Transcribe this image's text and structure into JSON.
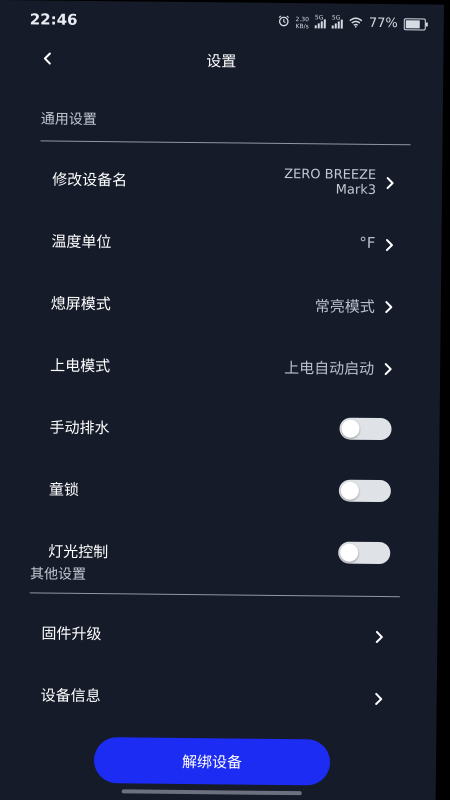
{
  "status_bar": {
    "time": "22:46",
    "net_speed_value": "2.30",
    "net_speed_unit": "KB/s",
    "signal_label_1": "5G",
    "signal_label_2": "5G",
    "battery_percent": "77%"
  },
  "nav": {
    "title": "设置"
  },
  "general_section": {
    "title": "通用设置",
    "items": [
      {
        "label": "修改设备名",
        "value_line1": "ZERO BREEZE",
        "value_line2": "Mark3"
      },
      {
        "label": "温度单位",
        "value": "°F"
      },
      {
        "label": "熄屏模式",
        "value": "常亮模式"
      },
      {
        "label": "上电模式",
        "value": "上电自动启动"
      },
      {
        "label": "手动排水",
        "toggle_on": false
      },
      {
        "label": "童锁",
        "toggle_on": false
      },
      {
        "label": "灯光控制",
        "toggle_on": false
      }
    ]
  },
  "other_section": {
    "title": "其他设置",
    "items": [
      {
        "label": "固件升级"
      },
      {
        "label": "设备信息"
      }
    ]
  },
  "unbind_button": {
    "label": "解绑设备"
  },
  "colors": {
    "background": "#151b29",
    "accent_button": "#1c2cf2",
    "toggle_off_track": "#dfe2e7",
    "secondary_text": "#b9bfcb"
  }
}
